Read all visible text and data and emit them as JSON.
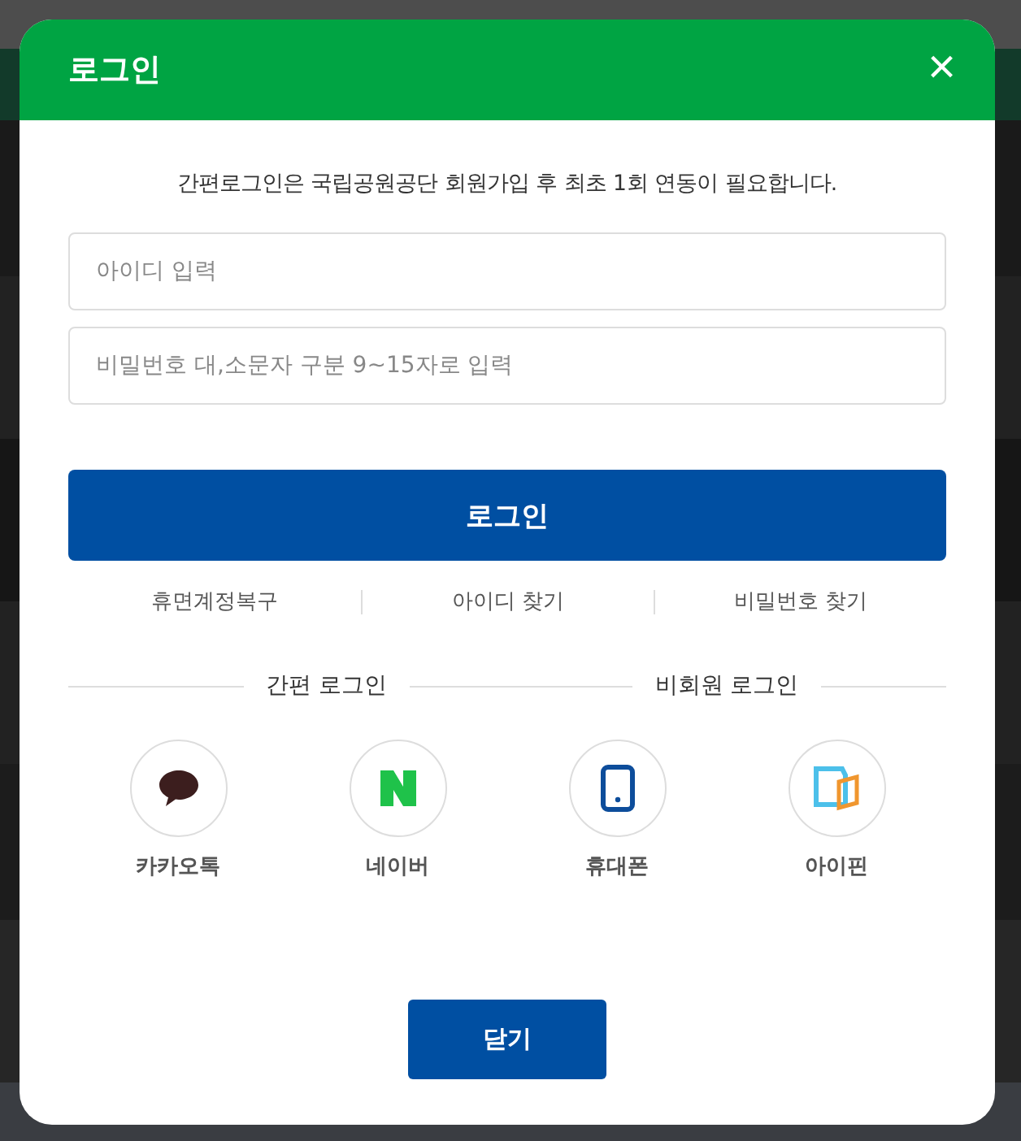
{
  "dialog": {
    "title": "로그인",
    "close_icon": "×"
  },
  "notice": "간편로그인은 국립공원공단 회원가입 후 최초 1회 연동이 필요합니다.",
  "fields": [
    {
      "placeholder": "아이디 입력"
    },
    {
      "placeholder": "비밀번호 대,소문자 구분 9~15자로 입력"
    }
  ],
  "login_button": "로그인",
  "links": [
    "휴면계정복구",
    "아이디 찾기",
    "비밀번호 찾기"
  ],
  "sections": [
    "간편 로그인",
    "비회원 로그인"
  ],
  "methods": [
    {
      "label": "카카오톡",
      "kind": "chat"
    },
    {
      "label": "네이버",
      "kind": "n"
    },
    {
      "label": "휴대폰",
      "kind": "phone"
    },
    {
      "label": "아이핀",
      "kind": "ipin"
    }
  ],
  "close_button": "닫기"
}
